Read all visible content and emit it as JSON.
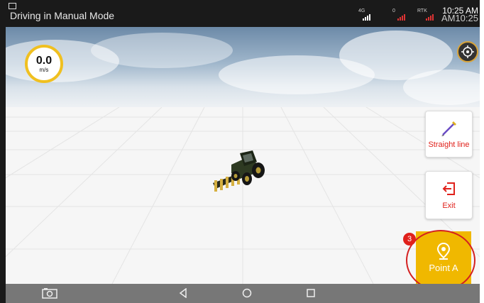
{
  "status_bar": {
    "title": "Driving in Manual Mode",
    "network_4g": "4G",
    "sat_count": "0",
    "rtk_label": "RTK",
    "time": "10:25 AM",
    "time_shadow": "AM10:25"
  },
  "speed_gauge": {
    "value": "0.0",
    "unit": "m/s",
    "ring_color": "#f0c020"
  },
  "toolbar": {
    "straight_line_label": "Straight line",
    "exit_label": "Exit",
    "point_a_label": "Point A",
    "point_a_color": "#f0b800",
    "label_color": "#e0211b"
  },
  "annotation": {
    "step_number": "3",
    "ring_color": "#d42020"
  },
  "icons": {
    "compass": "locate-icon",
    "straight_line": "pencil-line-icon",
    "exit": "exit-icon",
    "point_a": "map-pin-icon",
    "screenshot": "screenshot-icon",
    "back": "back-icon",
    "home": "home-icon",
    "recents": "recents-icon"
  }
}
